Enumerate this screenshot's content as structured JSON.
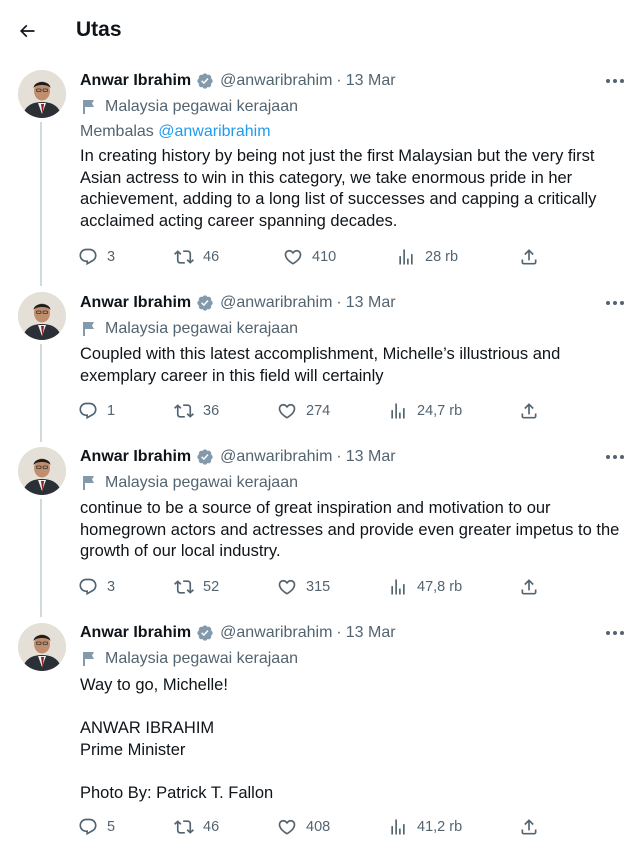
{
  "header": {
    "title": "Utas",
    "back_icon": "arrow-left-icon"
  },
  "colors": {
    "text": "#0f1419",
    "secondary": "#536471",
    "link": "#1d9bf0",
    "verified": "#829aab",
    "thread_line": "#cfd9de"
  },
  "tweets": [
    {
      "name": "Anwar Ibrahim",
      "handle": "@anwaribrahim",
      "separator": "·",
      "date": "13 Mar",
      "label": "Malaysia pegawai kerajaan",
      "reply_prefix": "Membalas",
      "reply_handle": "@anwaribrahim",
      "text": [
        "In creating history by being not just the first Malaysian but the very first Asian actress to win in this category, we take enormous pride in her achievement, adding to a long list of successes and capping a critically acclaimed acting career spanning decades."
      ],
      "stats": {
        "replies": "3",
        "retweets": "46",
        "likes": "410",
        "views": "28 rb"
      }
    },
    {
      "name": "Anwar Ibrahim",
      "handle": "@anwaribrahim",
      "separator": "·",
      "date": "13 Mar",
      "label": "Malaysia pegawai kerajaan",
      "text": [
        "Coupled with this latest accomplishment, Michelle’s illustrious and exemplary career in this field will certainly"
      ],
      "stats": {
        "replies": "1",
        "retweets": "36",
        "likes": "274",
        "views": "24,7 rb"
      }
    },
    {
      "name": "Anwar Ibrahim",
      "handle": "@anwaribrahim",
      "separator": "·",
      "date": "13 Mar",
      "label": "Malaysia pegawai kerajaan",
      "text": [
        "continue to be a source of great inspiration and motivation to our homegrown actors and actresses and provide even greater impetus to the growth of our local industry."
      ],
      "stats": {
        "replies": "3",
        "retweets": "52",
        "likes": "315",
        "views": "47,8 rb"
      }
    },
    {
      "name": "Anwar Ibrahim",
      "handle": "@anwaribrahim",
      "separator": "·",
      "date": "13 Mar",
      "label": "Malaysia pegawai kerajaan",
      "text": [
        "Way to go, Michelle!",
        "",
        "ANWAR IBRAHIM",
        "Prime Minister",
        "",
        "Photo By: Patrick T. Fallon"
      ],
      "stats": {
        "replies": "5",
        "retweets": "46",
        "likes": "408",
        "views": "41,2 rb"
      }
    }
  ],
  "icons": {
    "more": "more-horizontal-icon",
    "verified": "verified-badge-icon",
    "flag": "government-flag-icon",
    "reply": "reply-icon",
    "retweet": "retweet-icon",
    "like": "heart-icon",
    "views": "views-icon",
    "share": "share-icon"
  }
}
